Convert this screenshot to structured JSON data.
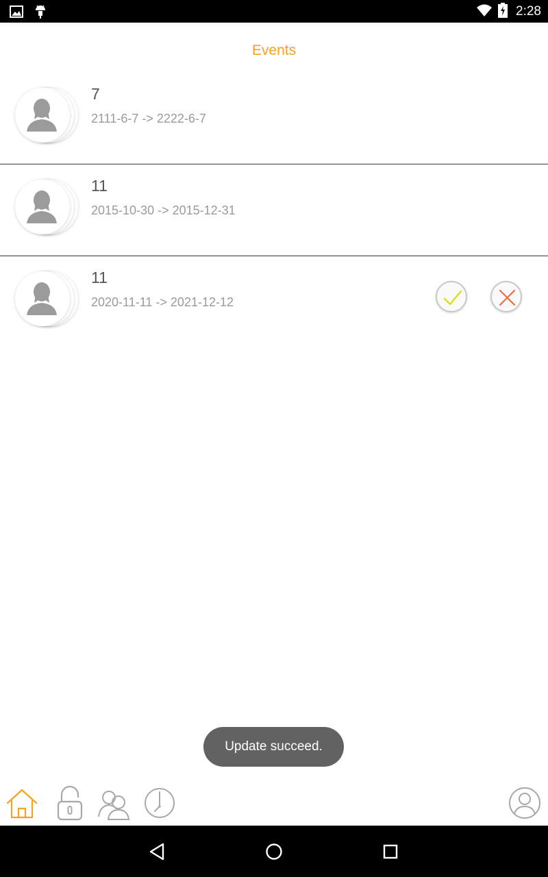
{
  "status_bar": {
    "time": "2:28",
    "icons": [
      "image-icon",
      "android-icon",
      "wifi-icon",
      "battery-charging-icon"
    ]
  },
  "header": {
    "title": "Events"
  },
  "events": [
    {
      "name": "7",
      "range": "2111-6-7 -> 2222-6-7"
    },
    {
      "name": "11",
      "range": "2015-10-30 -> 2015-12-31"
    },
    {
      "name": "11",
      "range": "2020-11-11 -> 2021-12-12",
      "actions": [
        "accept-check-icon",
        "reject-x-icon"
      ]
    }
  ],
  "toast": {
    "message": "Update succeed."
  },
  "bottom_tabs": [
    "home-icon",
    "unlock-icon",
    "people-icon",
    "clock-icon",
    "profile-icon"
  ],
  "nav_bar": [
    "back-icon",
    "home-circle-icon",
    "recents-icon"
  ],
  "colors": {
    "accent": "#f5a21e",
    "accept": "#d8e21c",
    "reject": "#ef6b45",
    "toast_bg": "#626262"
  }
}
